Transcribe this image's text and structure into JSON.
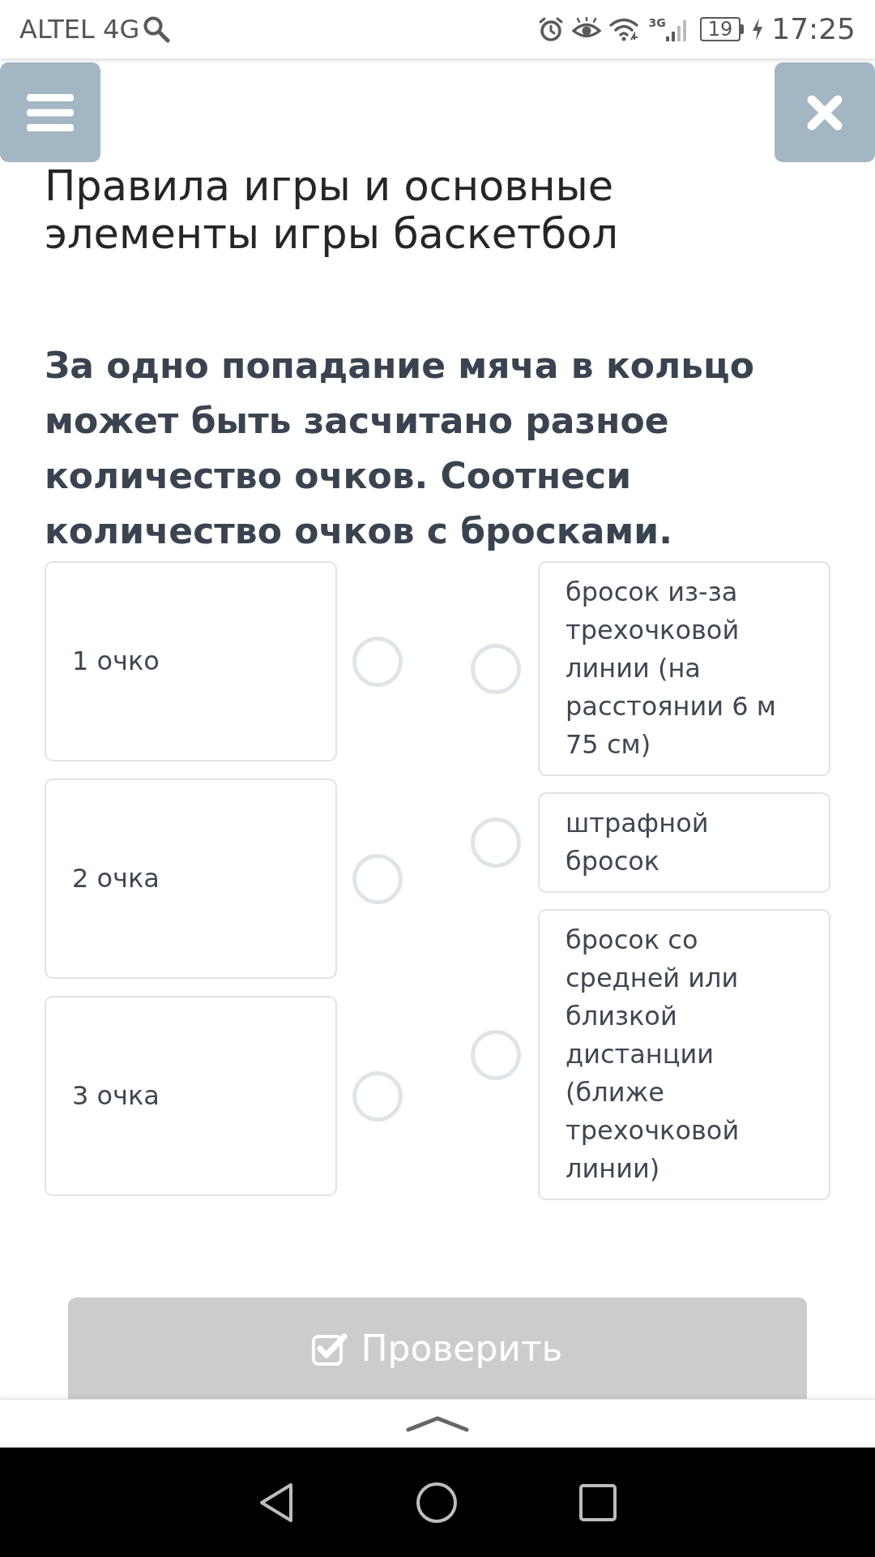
{
  "status_bar": {
    "carrier": "ALTEL 4G",
    "network": "3G",
    "battery": "19",
    "time": "17:25"
  },
  "header": {
    "title": "Правила игры и основные элементы игры баскетбол"
  },
  "question": {
    "text": "За одно попадание мяча в кольцо может быть засчитано разное количество очков. Соотнеси количество очков с бросками."
  },
  "left_items": [
    {
      "label": "1 очко"
    },
    {
      "label": "2 очка"
    },
    {
      "label": "3 очка"
    }
  ],
  "right_items": [
    {
      "label": "бросок из-за трехочковой линии (на расстоянии 6 м 75 см)"
    },
    {
      "label": "штрафной бросок"
    },
    {
      "label": "бросок со средней или близкой дистанции (ближе трехочковой линии)"
    }
  ],
  "check_button": {
    "label": "Проверить",
    "disabled": true
  }
}
